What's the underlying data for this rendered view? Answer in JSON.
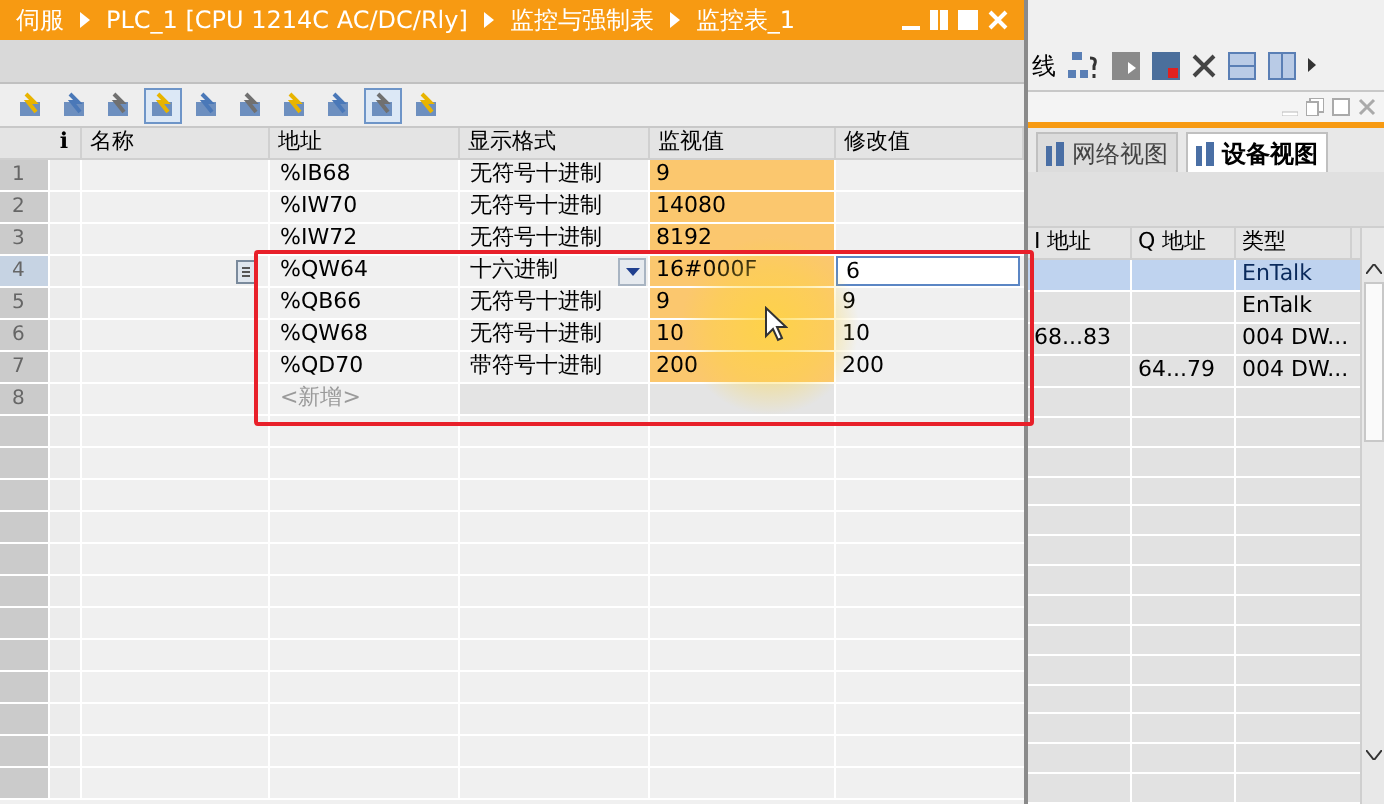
{
  "title_bar": {
    "breadcrumbs": [
      "伺服",
      "PLC_1 [CPU 1214C AC/DC/Rly]",
      "监控与强制表",
      "监控表_1"
    ]
  },
  "toolbar_buttons": [
    {
      "pressed": false
    },
    {
      "pressed": false
    },
    {
      "pressed": false
    },
    {
      "pressed": true
    },
    {
      "pressed": false
    },
    {
      "pressed": false
    },
    {
      "pressed": false
    },
    {
      "pressed": false
    },
    {
      "pressed": true
    },
    {
      "pressed": false
    }
  ],
  "table": {
    "columns": [
      "i",
      "名称",
      "地址",
      "显示格式",
      "监视值",
      "修改值"
    ],
    "rows": [
      {
        "kind": "entry",
        "number": "1",
        "address": "%IB68",
        "format": "无符号十进制",
        "monitor": "9",
        "selected": false
      },
      {
        "kind": "entry",
        "number": "2",
        "address": "%IW70",
        "format": "无符号十进制",
        "monitor": "14080",
        "selected": false
      },
      {
        "kind": "entry",
        "number": "3",
        "address": "%IW72",
        "format": "无符号十进制",
        "monitor": "8192",
        "selected": false
      },
      {
        "kind": "entry",
        "number": "4",
        "address": "%QW64",
        "format": "十六进制",
        "monitor": "16#000F",
        "modify": "6",
        "selected": true
      },
      {
        "kind": "entry",
        "number": "5",
        "address": "%QB66",
        "format": "无符号十进制",
        "monitor": "9",
        "modify": "9",
        "selected": false
      },
      {
        "kind": "entry",
        "number": "6",
        "address": "%QW68",
        "format": "无符号十进制",
        "monitor": "10",
        "modify": "10",
        "selected": false
      },
      {
        "kind": "entry",
        "number": "7",
        "address": "%QD70",
        "format": "带符号十进制",
        "monitor": "200",
        "modify": "200",
        "selected": false
      },
      {
        "kind": "new",
        "number": "8",
        "address": "<新增>",
        "selected": false
      }
    ]
  },
  "right_panel": {
    "toolbar_text": "线",
    "tabs": [
      {
        "label": "网络视图",
        "selected": false
      },
      {
        "label": "设备视图",
        "selected": true
      }
    ],
    "columns": [
      "I 地址",
      "Q 地址",
      "类型"
    ],
    "rows": [
      {
        "type": "EnTalk",
        "selected": true
      },
      {
        "type": "EnTalk",
        "selected": false
      },
      {
        "i_address": "68...83",
        "type": "004 DW...",
        "selected": false
      },
      {
        "q_address": "64...79",
        "type": "004 DW...",
        "selected": false
      }
    ]
  }
}
